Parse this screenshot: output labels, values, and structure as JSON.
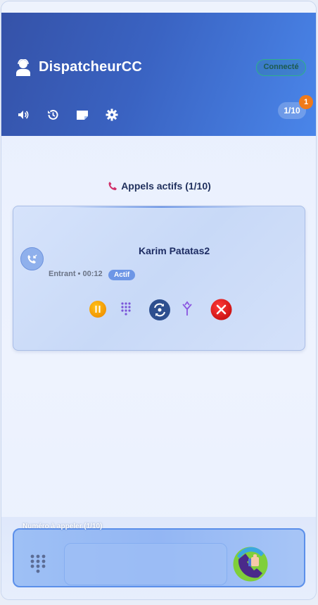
{
  "header": {
    "app_title": "DispatcheurCC",
    "status": "Connecté",
    "line_counter": "1/10",
    "notification_count": "1",
    "tools": [
      "speaker-icon",
      "history-icon",
      "notes-icon",
      "settings-icon"
    ]
  },
  "active_calls": {
    "title": "Appels actifs (1/10)",
    "calls": [
      {
        "caller": "Karim Patatas2",
        "direction": "Entrant",
        "duration": "00:12",
        "meta": "Entrant • 00:12",
        "state": "Actif"
      }
    ],
    "controls": [
      "hold-icon",
      "keypad-icon",
      "transfer-icon",
      "merge-icon",
      "hangup-icon"
    ]
  },
  "dialer": {
    "label": "Numéro à appeler (1/10)",
    "number_value": "",
    "number_placeholder": ""
  },
  "colors": {
    "header_start": "#3552a8",
    "header_end": "#4a86ea",
    "status_border": "#2fb08a",
    "hold": "#f5a000",
    "hangup": "#e02020",
    "notification": "#f07a1a"
  }
}
